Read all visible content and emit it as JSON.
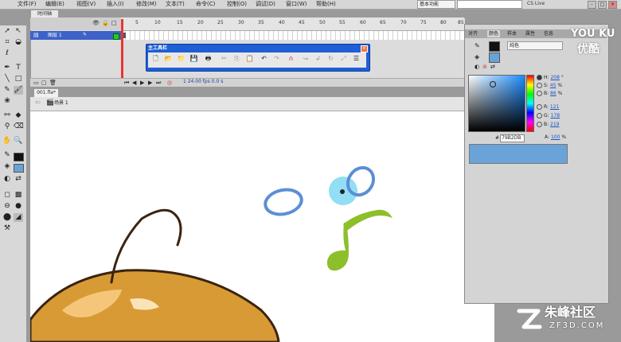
{
  "menubar": {
    "items": [
      "文件(F)",
      "编辑(E)",
      "视图(V)",
      "插入(I)",
      "修改(M)",
      "文本(T)",
      "命令(C)",
      "控制(O)",
      "调试(D)",
      "窗口(W)",
      "帮助(H)"
    ],
    "workspace": "基本功能",
    "cs_live": "CS Live",
    "win_buttons": [
      "-",
      "□",
      "×"
    ]
  },
  "timeline": {
    "tab_label": "时间轴",
    "layer_name": "图层 1",
    "frame_ticks": [
      "5",
      "10",
      "15",
      "20",
      "25",
      "30",
      "35",
      "40",
      "45",
      "50",
      "55",
      "60",
      "65",
      "70",
      "75",
      "80",
      "85"
    ],
    "status": "1   24.00 fps   0.0 s"
  },
  "main_toolbar": {
    "title": "主工具栏",
    "close": "×",
    "icons": [
      "new-file",
      "open-folder",
      "open-folder-2",
      "save",
      "print",
      "cut",
      "copy",
      "paste",
      "undo",
      "redo",
      "snap",
      "smooth",
      "straighten",
      "rotate",
      "scale",
      "align"
    ]
  },
  "document": {
    "tab_label": "001.fla*",
    "scene_label": "场景 1"
  },
  "color_panel": {
    "tabs": [
      "对齐",
      "颜色",
      "样本",
      "属性",
      "信息"
    ],
    "type": "纯色",
    "h": "208",
    "h_unit": "°",
    "s": "45",
    "s_unit": "%",
    "b": "86",
    "b_unit": "%",
    "r": "121",
    "g": "178",
    "bl": "219",
    "hex": "79B2DB",
    "alpha": "100",
    "alpha_unit": "%",
    "colors": {
      "stroke": "#111111",
      "fill": "#68a3d8",
      "preview": "#6aa3d8"
    }
  },
  "watermarks": {
    "youku": "YOU KU",
    "youku_cn": "优酷",
    "zhufeng": "朱峰社区",
    "zf3d": "ZF3D.COM"
  }
}
